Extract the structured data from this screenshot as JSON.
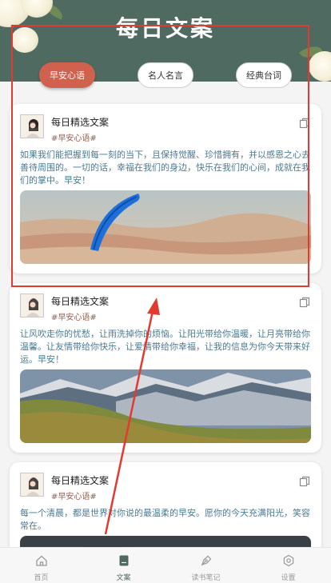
{
  "header": {
    "title": "每日文案"
  },
  "tabs": [
    {
      "label": "早安心语",
      "active": true
    },
    {
      "label": "名人名言",
      "active": false
    },
    {
      "label": "经典台词",
      "active": false
    }
  ],
  "cards": [
    {
      "title": "每日精选文案",
      "tag": "#早安心语#",
      "text": "如果我们能把握到每一刻的当下，且保持觉醒、珍惜拥有，并以感恩之心去善待周围的。一切的话，幸福在我们的身边，快乐在我们的心间，成就在我们的掌中。早安！",
      "image": "paraglider-desert"
    },
    {
      "title": "每日精选文案",
      "tag": "#早安心语#",
      "text": "让风吹走你的忧愁，让雨洗掉你的烦恼。让阳光带给你温暖，让月亮带给你温馨。让友情带给你快乐，让爱情带给你幸福，让我的信息为你今天带来好运。早安！",
      "image": "mountain-landscape"
    },
    {
      "title": "每日精选文案",
      "tag": "#早安心语#",
      "text": "每一个清晨，都是世界对你说的最温柔的早安。愿你的今天充满阳光，笑容常在。",
      "image": "dark-landscape"
    }
  ],
  "bottom_nav": [
    {
      "label": "首页",
      "icon": "home-icon",
      "active": false
    },
    {
      "label": "文案",
      "icon": "book-icon",
      "active": true
    },
    {
      "label": "读书笔记",
      "icon": "pen-nib-icon",
      "active": false
    },
    {
      "label": "设置",
      "icon": "settings-icon",
      "active": false
    }
  ],
  "colors": {
    "header_bg": "#4f6b61",
    "tab_active": "#d0614e",
    "text_blue": "#4a7a93",
    "tag_color": "#a05a4a",
    "highlight_border": "#e23a2e",
    "arrow": "#e23a2e"
  }
}
